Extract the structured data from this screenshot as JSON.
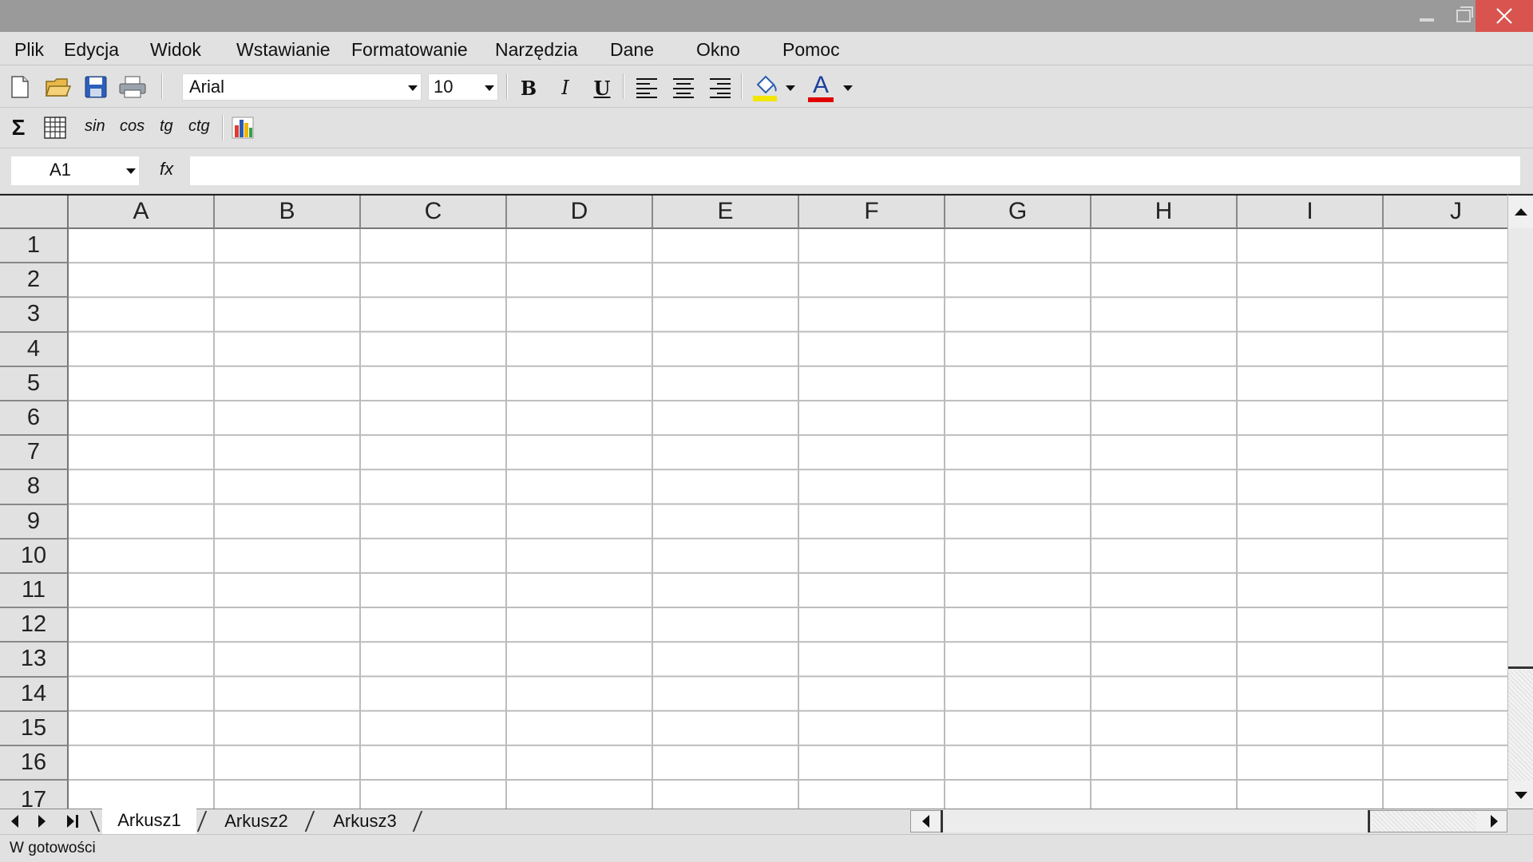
{
  "window": {
    "minimize_icon": "minimize-icon",
    "maximize_icon": "restore-icon",
    "close_icon": "close-icon",
    "close_color": "#d9534f"
  },
  "menu": {
    "items": [
      "Plik",
      "Edycja",
      "Widok",
      "Wstawianie",
      "Formatowanie",
      "Narzędzia",
      "Dane",
      "Okno",
      "Pomoc"
    ]
  },
  "toolbar": {
    "icons": [
      "new-document-icon",
      "open-folder-icon",
      "save-icon",
      "print-icon"
    ],
    "font_name": "Arial",
    "font_size": "10",
    "bold": "B",
    "italic": "I",
    "underline": "U",
    "align_icons": [
      "align-left-icon",
      "align-center-icon",
      "align-right-icon"
    ],
    "fill_color": "#f2e600",
    "font_color_letter": "A",
    "font_color": "#e00000"
  },
  "toolbar2": {
    "sum_symbol": "Σ",
    "functions": [
      "sin",
      "cos",
      "tg",
      "ctg"
    ]
  },
  "formula": {
    "cell_ref": "A1",
    "fx_label": "fx",
    "value": ""
  },
  "grid": {
    "columns": [
      "A",
      "B",
      "C",
      "D",
      "E",
      "F",
      "G",
      "H",
      "I",
      "J"
    ],
    "rows": [
      "1",
      "2",
      "3",
      "4",
      "5",
      "6",
      "7",
      "8",
      "9",
      "10",
      "11",
      "12",
      "13",
      "14",
      "15",
      "16",
      "17"
    ]
  },
  "sheets": {
    "tabs": [
      "Arkusz1",
      "Arkusz2",
      "Arkusz3"
    ],
    "active": "Arkusz1"
  },
  "status": {
    "text": "W gotowości"
  }
}
